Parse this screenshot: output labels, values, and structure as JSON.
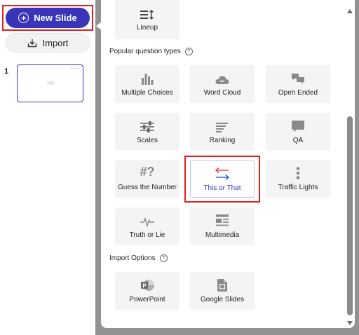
{
  "sidebar": {
    "new_slide_label": "New Slide",
    "import_label": "Import",
    "slide_number": "1",
    "slide_menu": "···"
  },
  "panel": {
    "top_tile": {
      "label": "Lineup",
      "icon": "lineup-icon"
    },
    "popular_heading": "Popular question types",
    "help_glyph": "?",
    "question_types": [
      {
        "label": "Multiple Choices",
        "icon": "bar-chart-icon"
      },
      {
        "label": "Word Cloud",
        "icon": "cloud-icon"
      },
      {
        "label": "Open Ended",
        "icon": "chat-bubbles-icon"
      },
      {
        "label": "Scales",
        "icon": "sliders-icon"
      },
      {
        "label": "Ranking",
        "icon": "ranking-lines-icon"
      },
      {
        "label": "QA",
        "icon": "speech-bubble-icon"
      },
      {
        "label": "Guess the Number",
        "icon": "hash-question-icon",
        "glyph": "#?"
      },
      {
        "label": "This or That",
        "icon": "swap-arrows-icon",
        "selected": true
      },
      {
        "label": "Traffic Lights",
        "icon": "vertical-dots-icon"
      },
      {
        "label": "Truth or Lie",
        "icon": "pulse-icon"
      },
      {
        "label": "Multimedia",
        "icon": "media-layout-icon"
      }
    ],
    "import_heading": "Import Options",
    "import_options": [
      {
        "label": "PowerPoint",
        "icon": "powerpoint-icon",
        "glyph": "P"
      },
      {
        "label": "Google Slides",
        "icon": "google-slides-icon"
      }
    ]
  },
  "colors": {
    "accent": "#3a35b8",
    "highlight": "#e02020",
    "overlay": "#929292",
    "tile_bg": "#f4f4f4",
    "icon_grey": "#8a8a8a",
    "swap_red": "#e8474c",
    "swap_blue": "#3a5bd9"
  }
}
